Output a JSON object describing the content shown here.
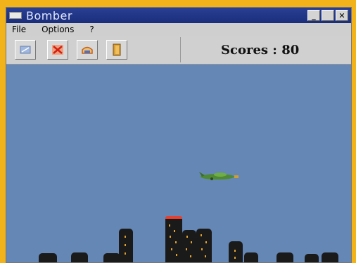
{
  "window": {
    "title": "Bomber"
  },
  "title_buttons": {
    "minimize": "_",
    "maximize": "",
    "close": "✕"
  },
  "menu": [
    "File",
    "Options",
    "?"
  ],
  "toolbar": {
    "tools": [
      {
        "icon": "new-game-icon",
        "color": "#a0b8e0"
      },
      {
        "icon": "bomb-icon",
        "color": "#e07050"
      },
      {
        "icon": "hangar-icon",
        "color": "#e09040"
      },
      {
        "icon": "exit-door-icon",
        "color": "#d8a030"
      }
    ]
  },
  "score": {
    "text": "Scores : 80"
  },
  "colors": {
    "frame": "#f2b21a",
    "sky": "#6487b6",
    "titlebar": "#1b2e7c",
    "building": "#1a1a1a",
    "windows": "#e0a030",
    "plane": "#4f8a32"
  }
}
